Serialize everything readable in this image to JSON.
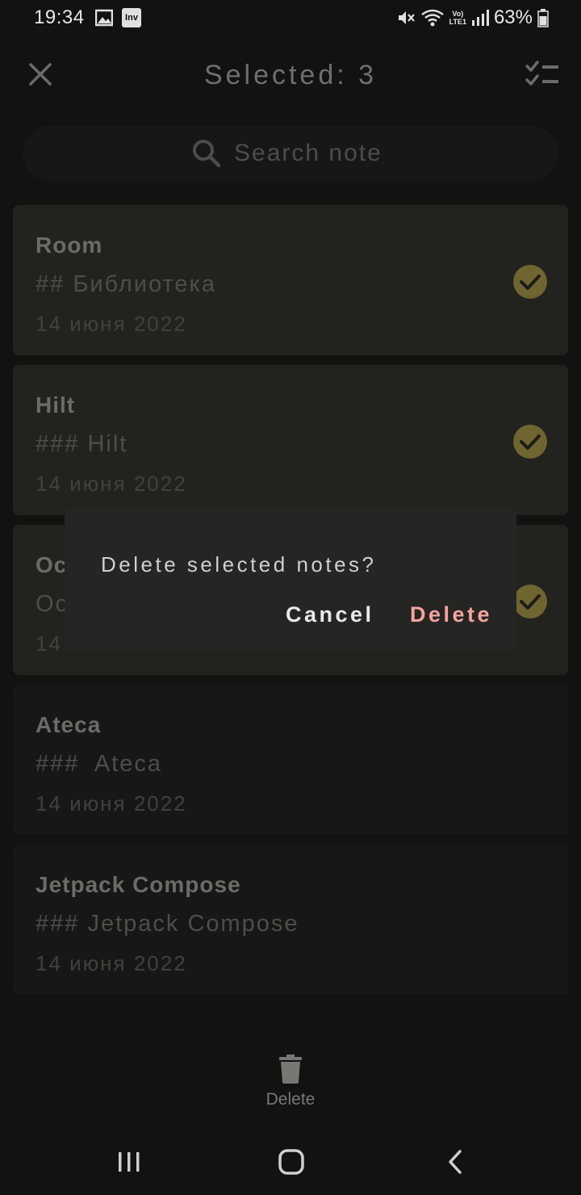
{
  "status_bar": {
    "time": "19:34",
    "inv_label": "Inv",
    "volte_top": "Vo)",
    "volte_bottom": "LTE1",
    "battery": "63%"
  },
  "app_bar": {
    "title": "Selected: 3"
  },
  "search": {
    "placeholder": "Search note"
  },
  "notes": [
    {
      "title": "Room",
      "preview": "## Библиотека",
      "date": "14 июня 2022",
      "selected": true
    },
    {
      "title": "Hilt",
      "preview": "### Hilt",
      "date": "14 июня 2022",
      "selected": true
    },
    {
      "title": "Oc",
      "preview": "Oc",
      "date": "14",
      "selected": true
    },
    {
      "title": "Ateca",
      "preview": "###  Ateca",
      "date": "14 июня 2022",
      "selected": false
    },
    {
      "title": "Jetpack Compose",
      "preview": "### Jetpack Compose",
      "date": "14 июня 2022",
      "selected": false
    }
  ],
  "dialog": {
    "message": "Delete selected notes?",
    "cancel_label": "Cancel",
    "delete_label": "Delete"
  },
  "bottom_bar": {
    "delete_label": "Delete"
  },
  "colors": {
    "background": "#121211",
    "check": "#6e6531",
    "dialog_bg": "#252523",
    "delete_accent": "#f6a39e"
  },
  "icons": {
    "close": "close-icon",
    "select_all": "checklist-icon",
    "search": "search-icon",
    "check": "check-circle-icon",
    "trash": "trash-icon"
  }
}
